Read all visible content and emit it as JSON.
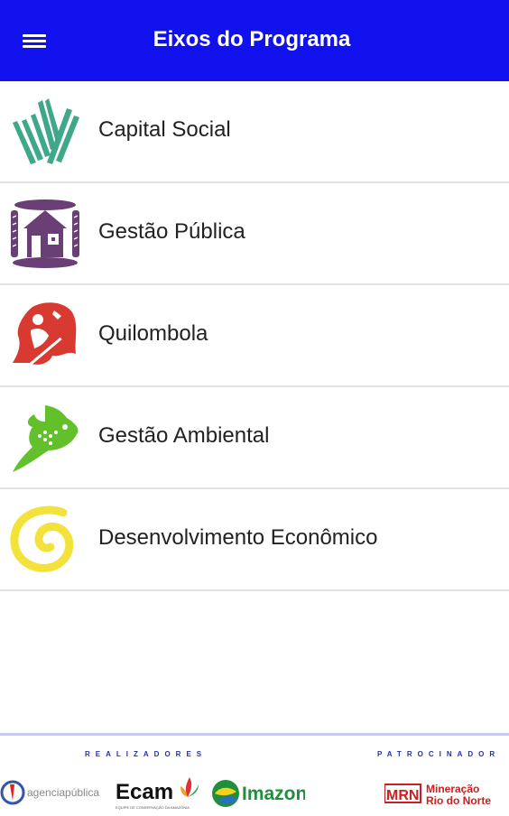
{
  "appbar": {
    "title": "Eixos do Programa",
    "menu_icon": "hamburger-menu-icon",
    "bg_color": "#1111ee"
  },
  "items": [
    {
      "label": "Capital Social",
      "icon": "capital-social-leaves-icon",
      "color": "#3fa88a"
    },
    {
      "label": "Gestão Pública",
      "icon": "gestao-publica-house-icon",
      "color": "#6a3f76"
    },
    {
      "label": "Quilombola",
      "icon": "quilombola-figure-icon",
      "color": "#d83a32"
    },
    {
      "label": "Gestão Ambiental",
      "icon": "gestao-ambiental-fish-icon",
      "color": "#62c12a"
    },
    {
      "label": "Desenvolvimento Econômico",
      "icon": "desenvolvimento-spiral-icon",
      "color": "#f2e23a"
    }
  ],
  "footer": {
    "realizadores_label": "REALIZADORES",
    "patrocinador_label": "PATROCINADOR",
    "logos": {
      "agencia": "agenciapública",
      "ecam": "Ecam",
      "ecam_sub": "EQUIPE DE CONSERVAÇÃO DA AMAZÔNIA",
      "imazon": "Imazon",
      "mrn": "MRN",
      "mrn_name_1": "Mineração",
      "mrn_name_2": "Rio do Norte"
    }
  }
}
